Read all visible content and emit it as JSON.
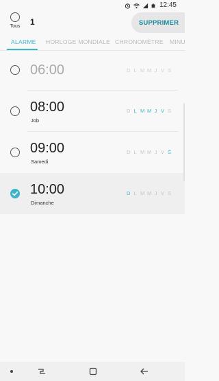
{
  "status_bar": {
    "time": "12:45",
    "icons": [
      "alarm-icon",
      "wifi-icon",
      "signal-icon",
      "battery-icon"
    ]
  },
  "header": {
    "select_all_label": "Tous",
    "selected_count": "1",
    "delete_label": "SUPPRIMER"
  },
  "tabs": [
    {
      "label": "ALARME",
      "active": true
    },
    {
      "label": "HORLOGE MONDIALE",
      "active": false
    },
    {
      "label": "CHRONOMÈTRE",
      "active": false
    },
    {
      "label": "MINUT",
      "active": false
    }
  ],
  "days_header": [
    "D",
    "L",
    "M",
    "M",
    "J",
    "V",
    "S"
  ],
  "alarms": [
    {
      "time": "06:00",
      "label": "",
      "checked": false,
      "enabled": false,
      "days_on": [
        false,
        false,
        false,
        false,
        false,
        false,
        false
      ]
    },
    {
      "time": "08:00",
      "label": "Job",
      "checked": false,
      "enabled": true,
      "days_on": [
        false,
        true,
        true,
        true,
        true,
        true,
        false
      ]
    },
    {
      "time": "09:00",
      "label": "Samedi",
      "checked": false,
      "enabled": true,
      "days_on": [
        false,
        false,
        false,
        false,
        false,
        false,
        true
      ]
    },
    {
      "time": "10:00",
      "label": "Dimanche",
      "checked": true,
      "enabled": true,
      "days_on": [
        true,
        false,
        false,
        false,
        false,
        false,
        false
      ]
    }
  ],
  "colors": {
    "accent": "#3fb4c8",
    "delete_text": "#1c8a9e",
    "day_off": "#c4c4c4"
  },
  "nav_bar": {
    "icons": [
      "dot-icon",
      "recent-apps-icon",
      "home-icon",
      "back-icon"
    ]
  }
}
